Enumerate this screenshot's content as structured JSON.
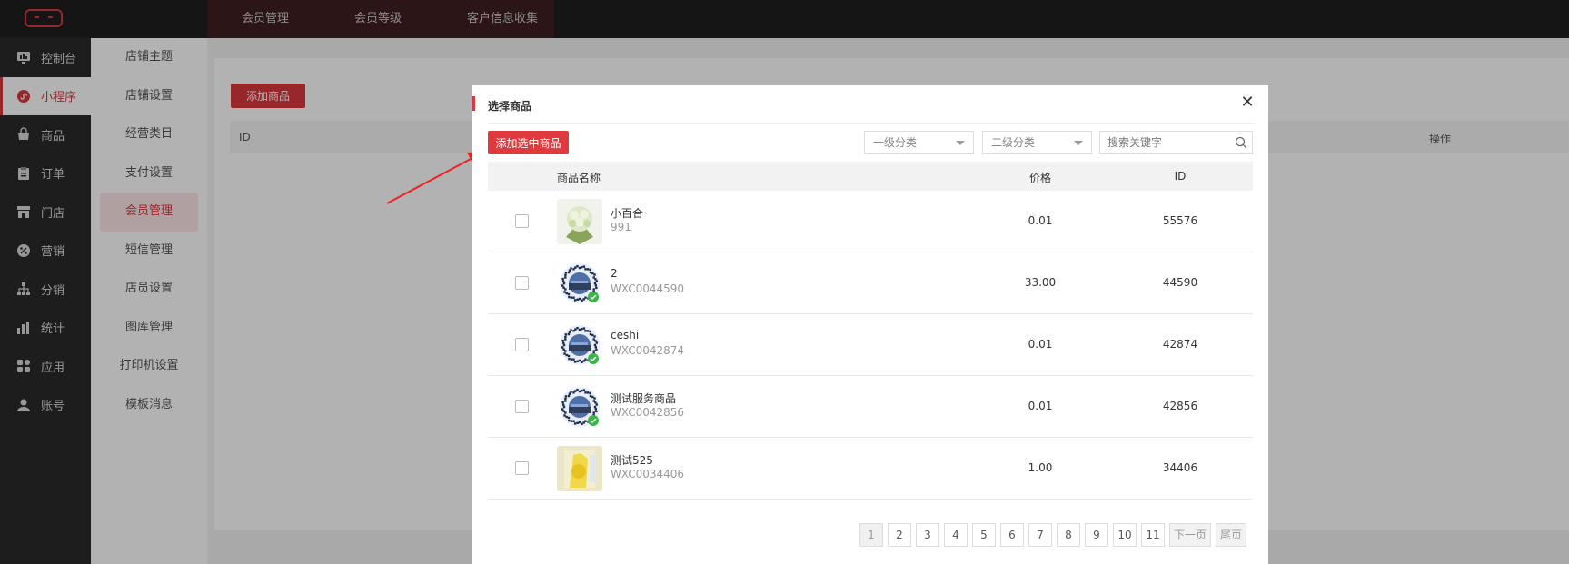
{
  "topnav": [
    "会员管理",
    "会员等级",
    "客户信息收集"
  ],
  "sidebar": [
    {
      "label": "控制台",
      "icon": "dashboard-icon"
    },
    {
      "label": "小程序",
      "icon": "miniprogram-icon",
      "active": true
    },
    {
      "label": "商品",
      "icon": "shopping-bag-icon"
    },
    {
      "label": "订单",
      "icon": "clipboard-icon"
    },
    {
      "label": "门店",
      "icon": "store-icon"
    },
    {
      "label": "营销",
      "icon": "percent-icon"
    },
    {
      "label": "分销",
      "icon": "hierarchy-icon"
    },
    {
      "label": "统计",
      "icon": "bar-chart-icon"
    },
    {
      "label": "应用",
      "icon": "apps-grid-icon"
    },
    {
      "label": "账号",
      "icon": "user-icon"
    }
  ],
  "subsidebar": [
    "店铺主题",
    "店铺设置",
    "经营类目",
    "支付设置",
    "会员管理",
    "短信管理",
    "店员设置",
    "图库管理",
    "打印机设置",
    "模板消息"
  ],
  "subsidebar_active": "会员管理",
  "main": {
    "add_button": "添加商品",
    "table_headers": {
      "id": "ID",
      "op": "操作"
    }
  },
  "modal": {
    "title": "选择商品",
    "add_selected": "添加选中商品",
    "category1": "一级分类",
    "category2": "二级分类",
    "search_placeholder": "搜索关键字",
    "columns": {
      "name": "商品名称",
      "price": "价格",
      "id": "ID"
    },
    "products": [
      {
        "name": "小百合",
        "code": "991",
        "price": "0.01",
        "id": "55576",
        "thumb": "flower"
      },
      {
        "name": "2",
        "code": "WXC0044590",
        "price": "33.00",
        "id": "44590",
        "thumb": "qrcode"
      },
      {
        "name": "ceshi",
        "code": "WXC0042874",
        "price": "0.01",
        "id": "42874",
        "thumb": "qrcode"
      },
      {
        "name": "测试服务商品",
        "code": "WXC0042856",
        "price": "0.01",
        "id": "42856",
        "thumb": "qrcode"
      },
      {
        "name": "测试525",
        "code": "WXC0034406",
        "price": "1.00",
        "id": "34406",
        "thumb": "yellow"
      }
    ],
    "pagination": {
      "pages": [
        "1",
        "2",
        "3",
        "4",
        "5",
        "6",
        "7",
        "8",
        "9",
        "10",
        "11"
      ],
      "current": "1",
      "next": "下一页",
      "last": "尾页"
    }
  },
  "colors": {
    "accent": "#d8393d",
    "sidebar_bg": "#2a2a2a",
    "topbar_bg": "#1f1f1f"
  }
}
